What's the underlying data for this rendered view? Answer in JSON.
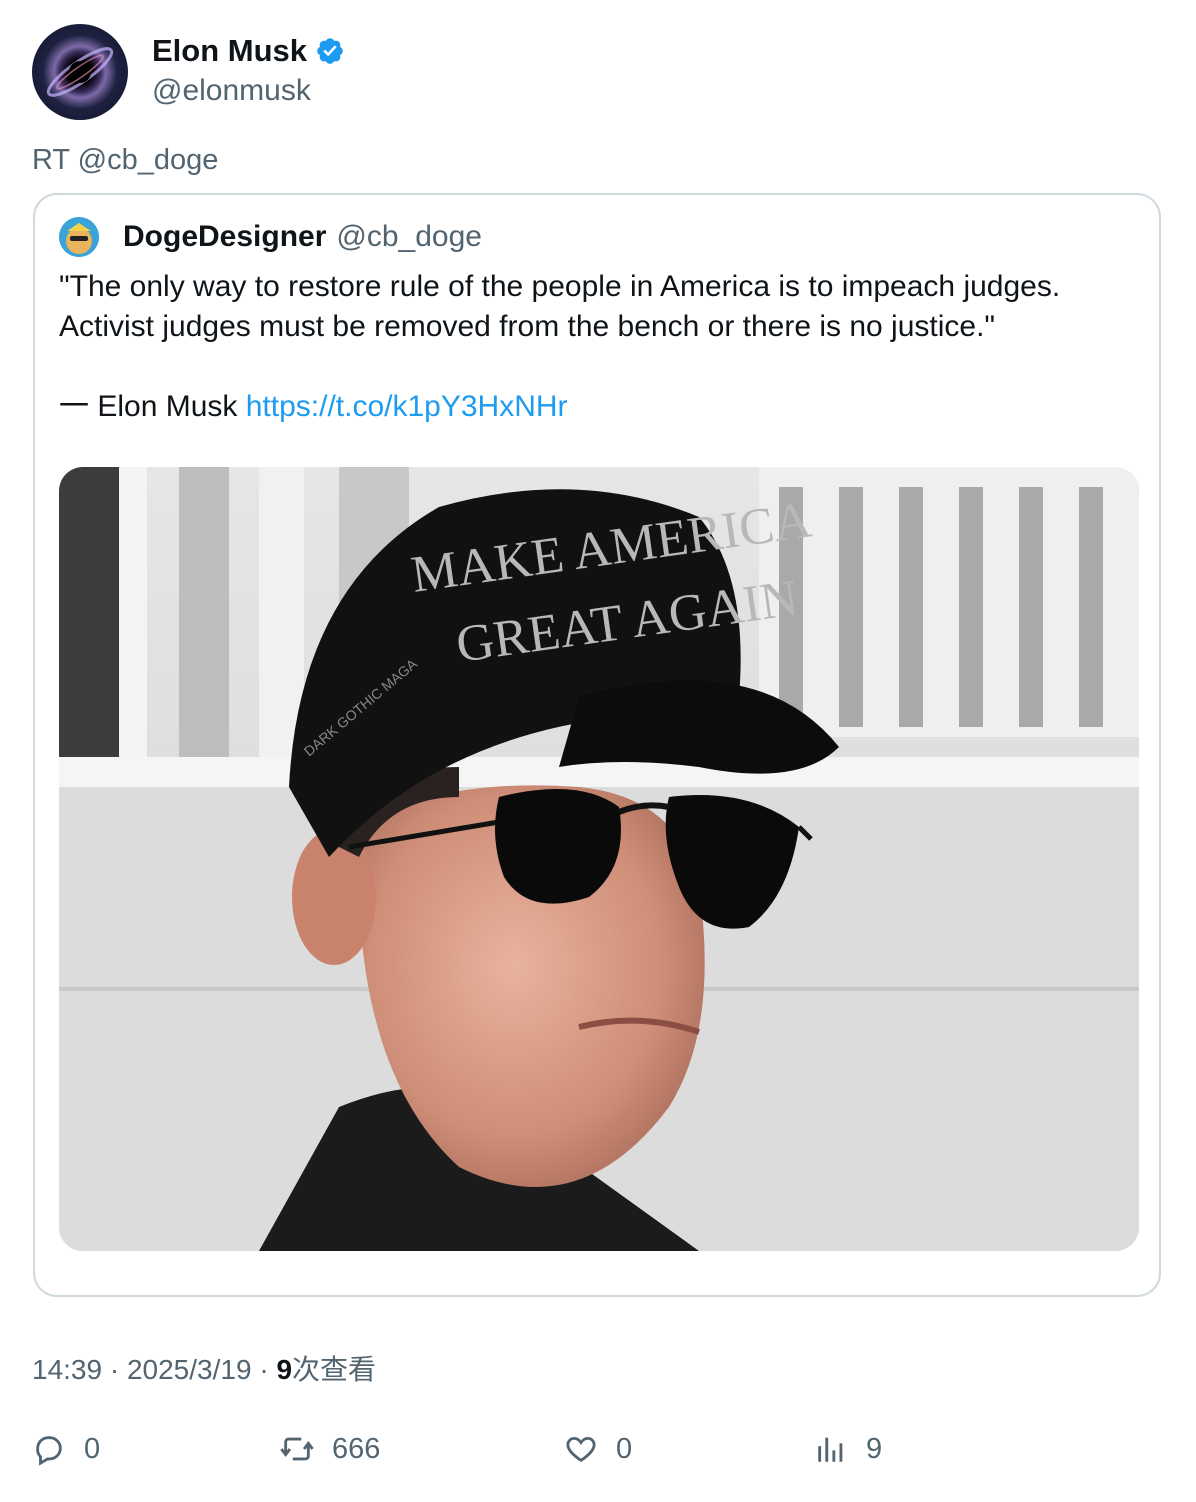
{
  "author": {
    "display_name": "Elon Musk",
    "handle": "@elonmusk",
    "verified_icon": "verified-badge-icon"
  },
  "retweet_line": "RT @cb_doge",
  "quoted": {
    "display_name": "DogeDesigner",
    "handle": "@cb_doge",
    "text_line1": "\"The only way to restore rule of the people in America is to impeach judges.",
    "text_line2": "Activist judges must be removed from the bench or there is no justice.\"",
    "attribution": "一 Elon Musk ",
    "link": "https://t.co/k1pY3HxNHr",
    "photo": {
      "hat_line1": "MAKE AMERICA",
      "hat_line2": "GREAT AGAIN",
      "hat_side": "DARK GOTHIC MAGA"
    }
  },
  "meta": {
    "time": "14:39",
    "sep1": " · ",
    "date": "2025/3/19",
    "sep2": " · ",
    "views_count": "9",
    "views_label": "次查看"
  },
  "actions": {
    "reply_count": "0",
    "retweet_count": "666",
    "like_count": "0",
    "views_count": "9"
  },
  "colors": {
    "link": "#1d9bf0",
    "verified": "#1d9bf0",
    "muted": "#536471",
    "border": "#cfd9de"
  }
}
